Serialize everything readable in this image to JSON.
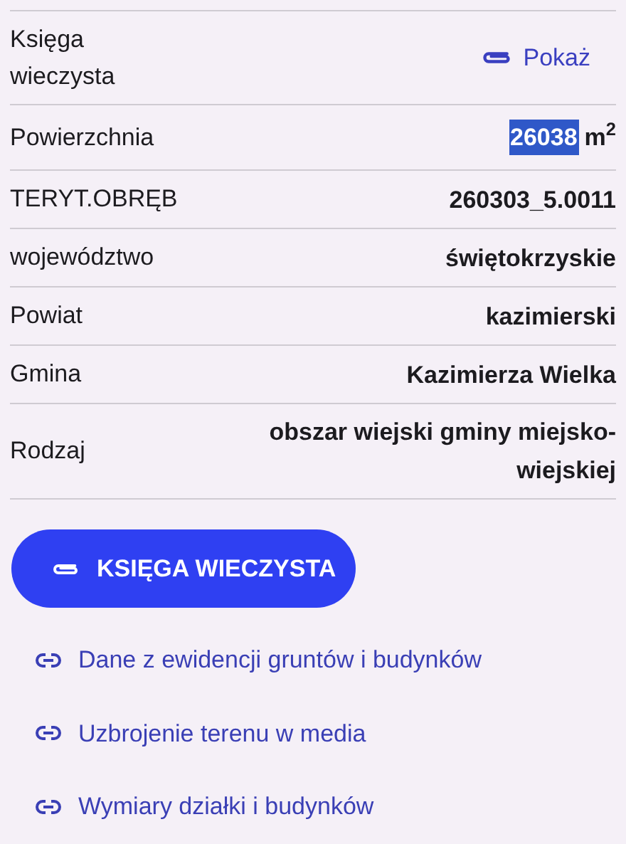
{
  "rows": [
    {
      "kind": "link",
      "label": "Księga wieczysta",
      "value": "Pokaż"
    },
    {
      "kind": "area",
      "label": "Powierzchnia",
      "value": "26038",
      "unit": "m$^{2}$",
      "selected": true
    },
    {
      "kind": "text",
      "label": "TERYT.OBRĘB",
      "value": "260303_5.0011"
    },
    {
      "kind": "text",
      "label": "województwo",
      "value": "świętokrzyskie"
    },
    {
      "kind": "text",
      "label": "Powiat",
      "value": "kazimierski"
    },
    {
      "kind": "text",
      "label": "Gmina",
      "value": "Kazimierza Wielka"
    },
    {
      "kind": "text",
      "label": "Rodzaj",
      "value": "obszar wiejski gminy miejsko-wiejskiej"
    }
  ],
  "button": {
    "label": "KSIĘGA WIECZYSTA"
  },
  "links": [
    "Dane z ewidencji gruntów i budynków",
    "Uzbrojenie terenu w media",
    "Wymiary działki i budynków"
  ]
}
